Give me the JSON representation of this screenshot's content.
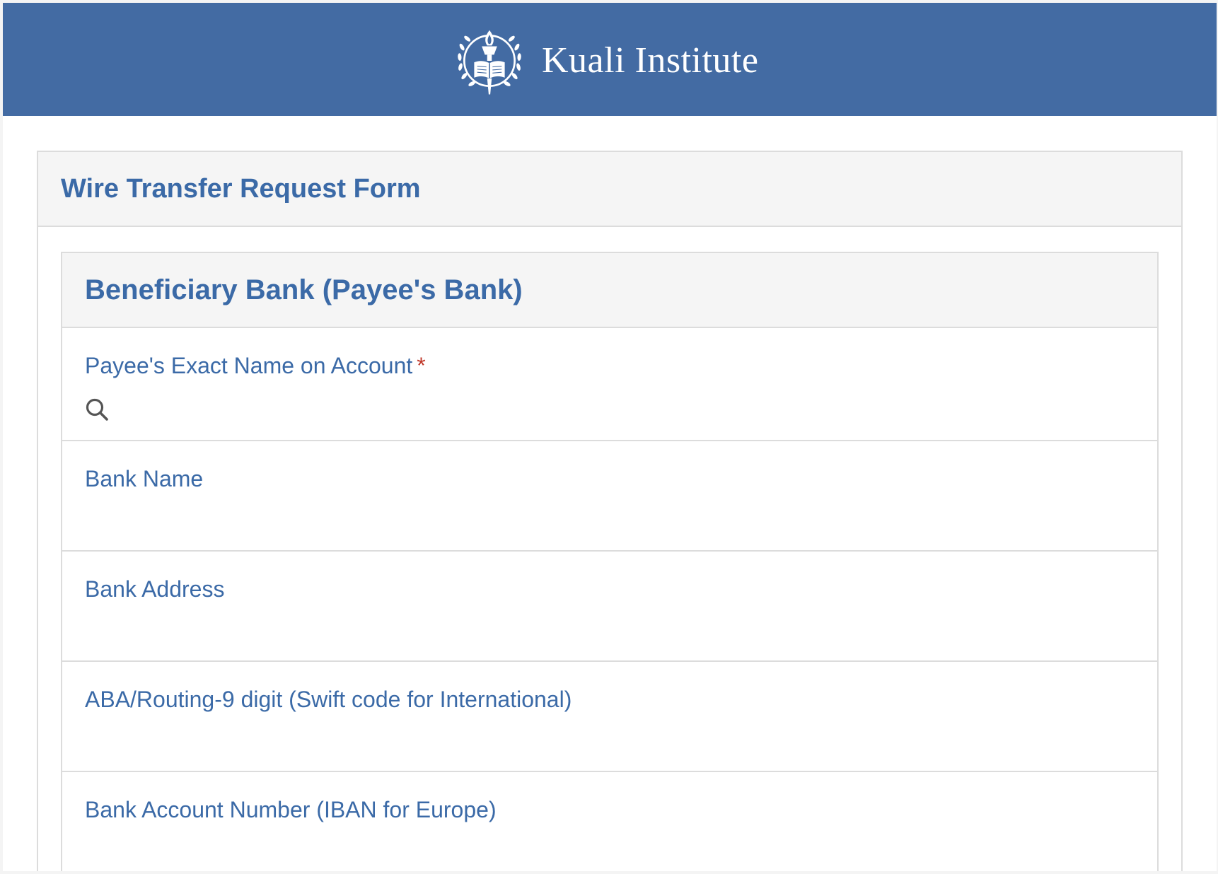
{
  "header": {
    "institution_name": "Kuali Institute",
    "logo_icon": "torch-seal-icon",
    "background_color": "#436ba3"
  },
  "form": {
    "title": "Wire Transfer Request Form",
    "section": {
      "title": "Beneficiary Bank (Payee's Bank)",
      "fields": [
        {
          "label": "Payee's Exact Name on Account",
          "required": true,
          "required_marker": "*",
          "icon": "search-icon",
          "value": ""
        },
        {
          "label": "Bank Name",
          "value": ""
        },
        {
          "label": "Bank Address",
          "value": ""
        },
        {
          "label": "ABA/Routing-9 digit (Swift code for International)",
          "value": ""
        },
        {
          "label": "Bank Account Number (IBAN for Europe)",
          "value": ""
        }
      ]
    }
  },
  "colors": {
    "label_text": "#3b6aa7",
    "required_marker": "#c0392b",
    "panel_header_bg": "#f5f5f5",
    "border": "#dcdcdc"
  }
}
